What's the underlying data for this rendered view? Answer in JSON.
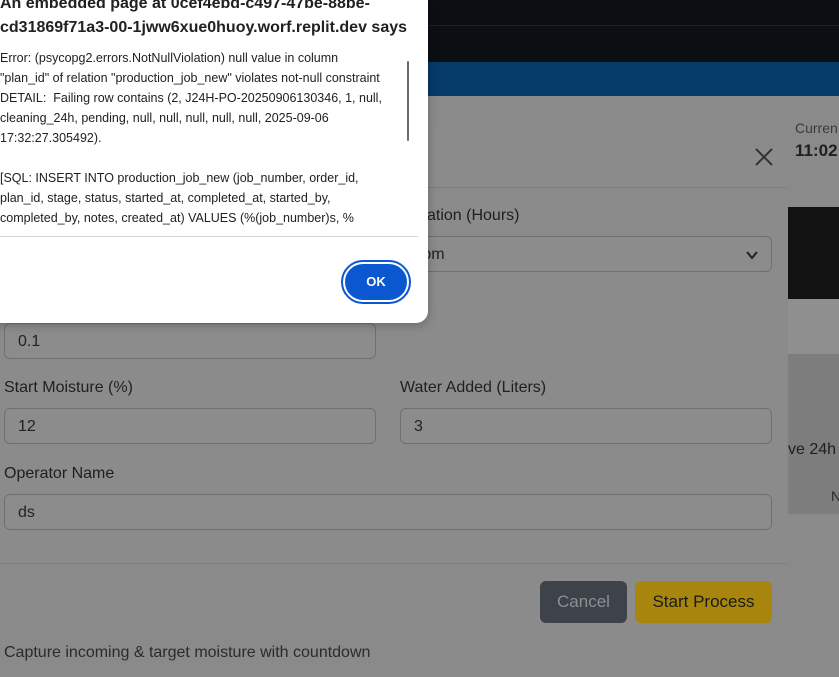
{
  "background": {
    "current_label": "Curren",
    "current_time": "11:02:",
    "snippet_24h": "ve 24h",
    "snippet_n": "N",
    "caption": "Capture incoming & target moisture with countdown"
  },
  "modal": {
    "duration_label": "ation (Hours)",
    "duration_value": "ustom",
    "hours_value": "0.1",
    "start_moisture_label": "Start Moisture (%)",
    "start_moisture_value": "12",
    "water_added_label": "Water Added (Liters)",
    "water_added_value": "3",
    "operator_label": "Operator Name",
    "operator_value": "ds",
    "cancel_label": "Cancel",
    "start_label": "Start Process"
  },
  "alert": {
    "title": "An embedded page at 0cef4ebd-c497-47be-88be-cd31869f71a3-00-1jww6xue0huoy.worf.replit.dev says",
    "message": "Error: (psycopg2.errors.NotNullViolation) null value in column \"plan_id\" of relation \"production_job_new\" violates not-null constraint\nDETAIL:  Failing row contains (2, J24H-PO-20250906130346, 1, null, cleaning_24h, pending, null, null, null, null, null, 2025-09-06 17:32:27.305492).\n\n[SQL: INSERT INTO production_job_new (job_number, order_id, plan_id, stage, status, started_at, completed_at, started_by, completed_by, notes, created_at) VALUES (%(job_number)s, %",
    "ok_label": "OK"
  },
  "colors": {
    "alert_button": "#0b57d0",
    "start_button": "#a8860e",
    "cancel_button": "#3e4249",
    "header_bar": "#053b69"
  }
}
